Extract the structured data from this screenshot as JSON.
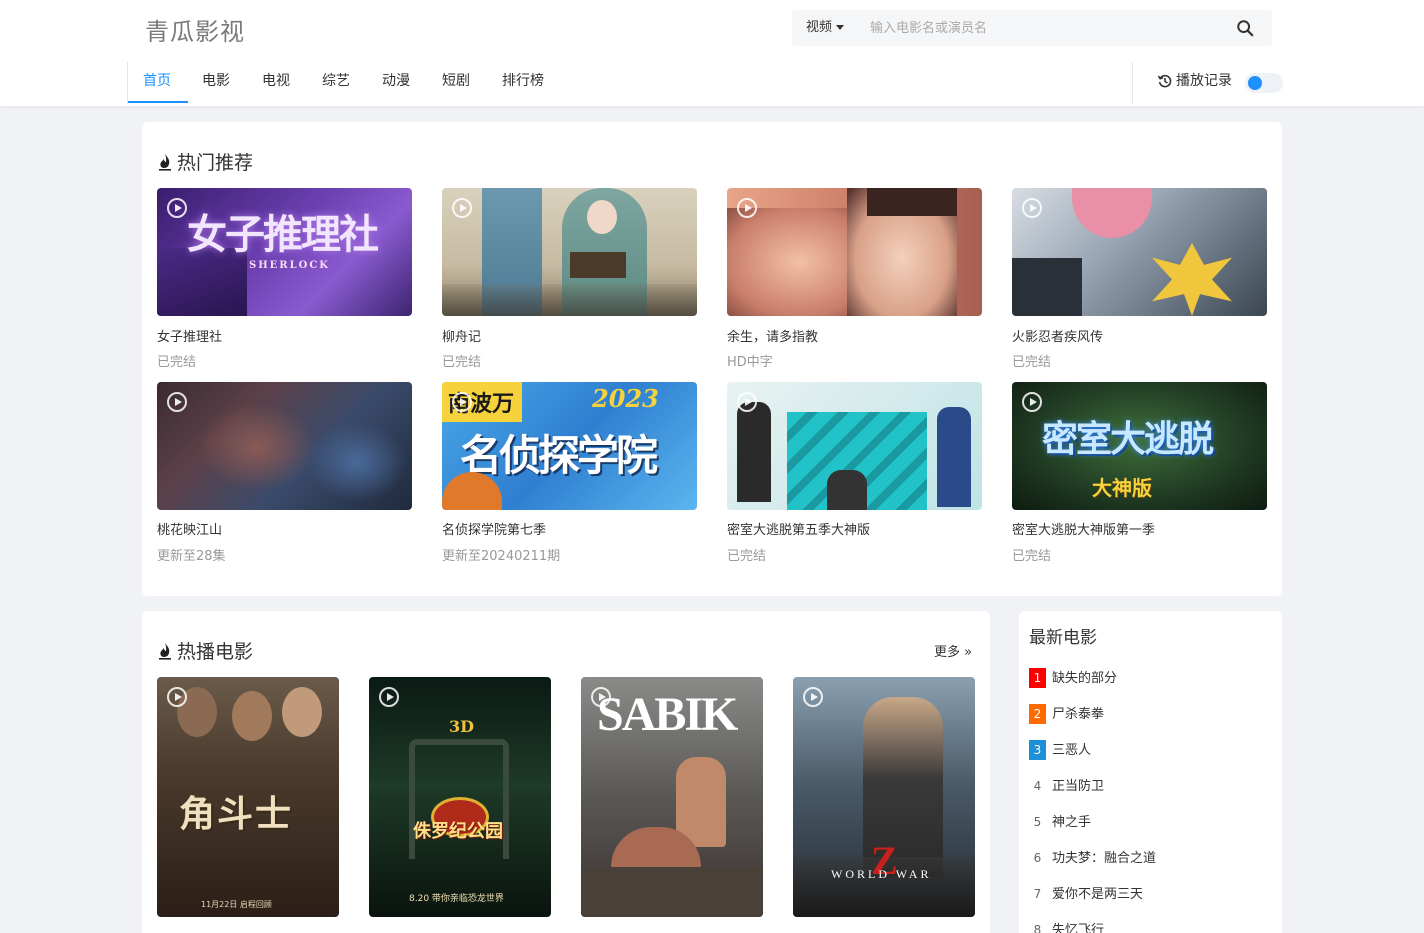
{
  "site": {
    "logo": "青瓜影视"
  },
  "search": {
    "type_label": "视频",
    "placeholder": "输入电影名或演员名"
  },
  "nav": {
    "items": [
      "首页",
      "电影",
      "电视",
      "综艺",
      "动漫",
      "短剧",
      "排行榜"
    ],
    "active": "首页"
  },
  "history": {
    "label": "播放记录"
  },
  "hot": {
    "title": "热门推荐",
    "cards": [
      {
        "title": "女子推理社",
        "status": "已完结",
        "overlay": "女子推理社",
        "overlay_sub": "SHERLOCK"
      },
      {
        "title": "柳舟记",
        "status": "已完结"
      },
      {
        "title": "余生，请多指教",
        "status": "HD中字"
      },
      {
        "title": "火影忍者疾风传",
        "status": "已完结"
      },
      {
        "title": "桃花映江山",
        "status": "更新至28集"
      },
      {
        "title": "名侦探学院第七季",
        "status": "更新至20240211期",
        "overlay": "名侦探学院",
        "overlay_top": "南波万",
        "overlay_year": "2023"
      },
      {
        "title": "密室大逃脱第五季大神版",
        "status": "已完结"
      },
      {
        "title": "密室大逃脱大神版第一季",
        "status": "已完结",
        "overlay": "密室大逃脱",
        "overlay_sub": "大神版"
      }
    ]
  },
  "movies": {
    "title": "热播电影",
    "more_label": "更多 »",
    "posters": [
      {
        "overlay": "角斗士",
        "overlay_sub": "11月22日 启程回顾"
      },
      {
        "overlay": "侏罗纪公园",
        "overlay_top": "3D",
        "overlay_sub": "8.20 带你亲临恐龙世界"
      },
      {
        "overlay": "SABIK"
      },
      {
        "overlay": "Z",
        "overlay_sub": "WORLD  WAR"
      }
    ]
  },
  "latest": {
    "title": "最新电影",
    "items": [
      "缺失的部分",
      "尸杀泰拳",
      "三恶人",
      "正当防卫",
      "神之手",
      "功夫梦：融合之道",
      "爱你不是两三天",
      "失忆飞行"
    ]
  },
  "colors": {
    "accent": "#1e90ff",
    "rank1": "#ff0000",
    "rank2": "#ff6a00",
    "rank3": "#1e90d8"
  }
}
